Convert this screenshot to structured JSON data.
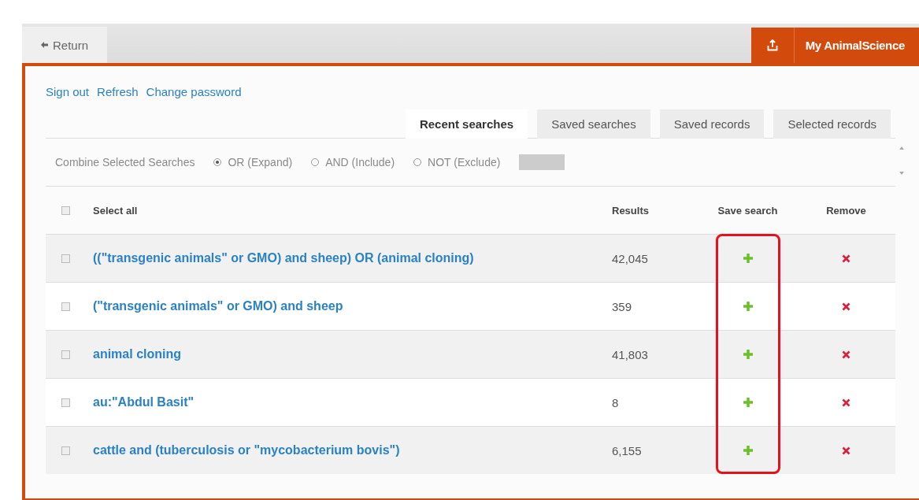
{
  "top_bar": {
    "return_tab": {
      "label": "Return"
    },
    "account_tab": {
      "label": "My AnimalScience"
    }
  },
  "links": [
    "Sign out",
    "Refresh",
    "Change password"
  ],
  "tabs": [
    {
      "label": "Recent searches",
      "selected": true
    },
    {
      "label": "Saved searches",
      "selected": false
    },
    {
      "label": "Saved records",
      "selected": false
    },
    {
      "label": "Selected records",
      "selected": false
    }
  ],
  "combine": {
    "label": "Combine Selected Searches",
    "disabled": true,
    "options": [
      {
        "label": "OR (Expand)",
        "selected": true
      },
      {
        "label": "AND (Include)",
        "selected": false
      },
      {
        "label": "NOT (Exclude)",
        "selected": false
      }
    ]
  },
  "table": {
    "columns": [
      {
        "label": "Select all",
        "kind": "select"
      },
      {
        "label": "Results",
        "kind": "results"
      },
      {
        "label": "Save search",
        "kind": "save",
        "highlighted": true
      },
      {
        "label": "Remove",
        "kind": "remove"
      }
    ],
    "select_all_checked": false,
    "rows": [
      {
        "query": "((\"transgenic animals\" or GMO) and sheep) OR (animal cloning)",
        "results": "42,045",
        "checked": false
      },
      {
        "query": "(\"transgenic animals\" or GMO) and sheep",
        "results": "359",
        "checked": false
      },
      {
        "query": "animal cloning",
        "results": "41,803",
        "checked": false
      },
      {
        "query": "au:\"Abdul Basit\"",
        "results": "8",
        "checked": false
      },
      {
        "query": "cattle and (tuberculosis or \"mycobacterium bovis\")",
        "results": "6,155",
        "checked": false
      }
    ]
  }
}
